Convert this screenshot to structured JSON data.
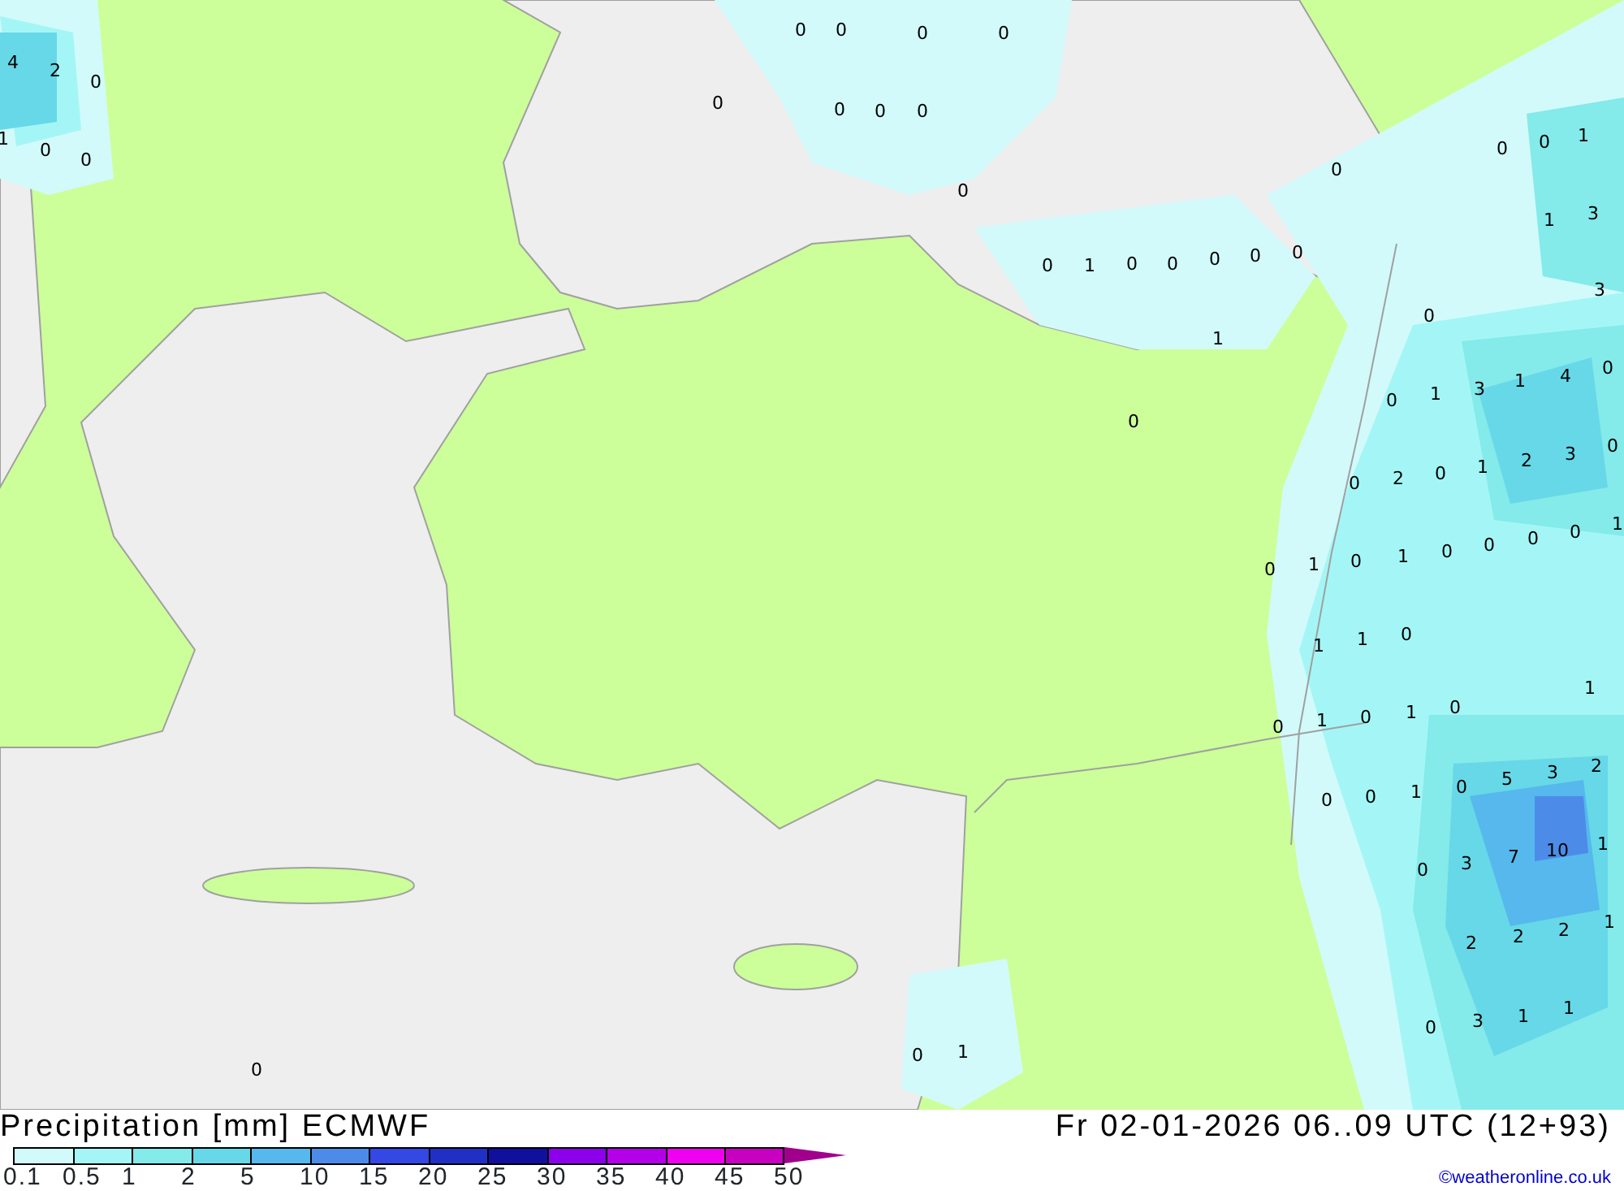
{
  "map": {
    "values": [
      "0",
      "0",
      "0",
      "0",
      "0",
      "0",
      "0",
      "0",
      "0",
      "0",
      "1",
      "0",
      "0",
      "0",
      "0",
      "0",
      "1",
      "0",
      "4",
      "2",
      "0",
      "1",
      "0",
      "0",
      "0",
      "0",
      "0",
      "1",
      "1",
      "3",
      "3",
      "0",
      "0",
      "1",
      "3",
      "1",
      "4",
      "0",
      "0",
      "2",
      "0",
      "1",
      "2",
      "3",
      "0",
      "0",
      "1",
      "0",
      "1",
      "0",
      "0",
      "0",
      "0",
      "1",
      "1",
      "1",
      "0",
      "0",
      "1",
      "0",
      "1",
      "0",
      "1",
      "0",
      "0",
      "1",
      "0",
      "5",
      "3",
      "2",
      "0",
      "3",
      "7",
      "10",
      "1",
      "2",
      "2",
      "2",
      "1",
      "0",
      "3",
      "1",
      "1",
      "0",
      "0",
      "1"
    ]
  },
  "footer": {
    "title": "Precipitation [mm] ECMWF",
    "valid_time": "Fr 02-01-2026 06..09 UTC (12+93)",
    "credit": "©weatheronline.co.uk"
  },
  "legend": [
    {
      "label": "0.1",
      "color": "#d2fafa"
    },
    {
      "label": "0.5",
      "color": "#a4f6f6"
    },
    {
      "label": "1",
      "color": "#84eaea"
    },
    {
      "label": "2",
      "color": "#66d8e8"
    },
    {
      "label": "5",
      "color": "#56b8ec"
    },
    {
      "label": "10",
      "color": "#4c8ce8"
    },
    {
      "label": "15",
      "color": "#3448e4"
    },
    {
      "label": "20",
      "color": "#2030c4"
    },
    {
      "label": "25",
      "color": "#10109c"
    },
    {
      "label": "30",
      "color": "#8c00ec"
    },
    {
      "label": "35",
      "color": "#b400e8"
    },
    {
      "label": "40",
      "color": "#f000f0"
    },
    {
      "label": "45",
      "color": "#c800c0"
    },
    {
      "label": "50",
      "color": "#a0008c"
    }
  ]
}
